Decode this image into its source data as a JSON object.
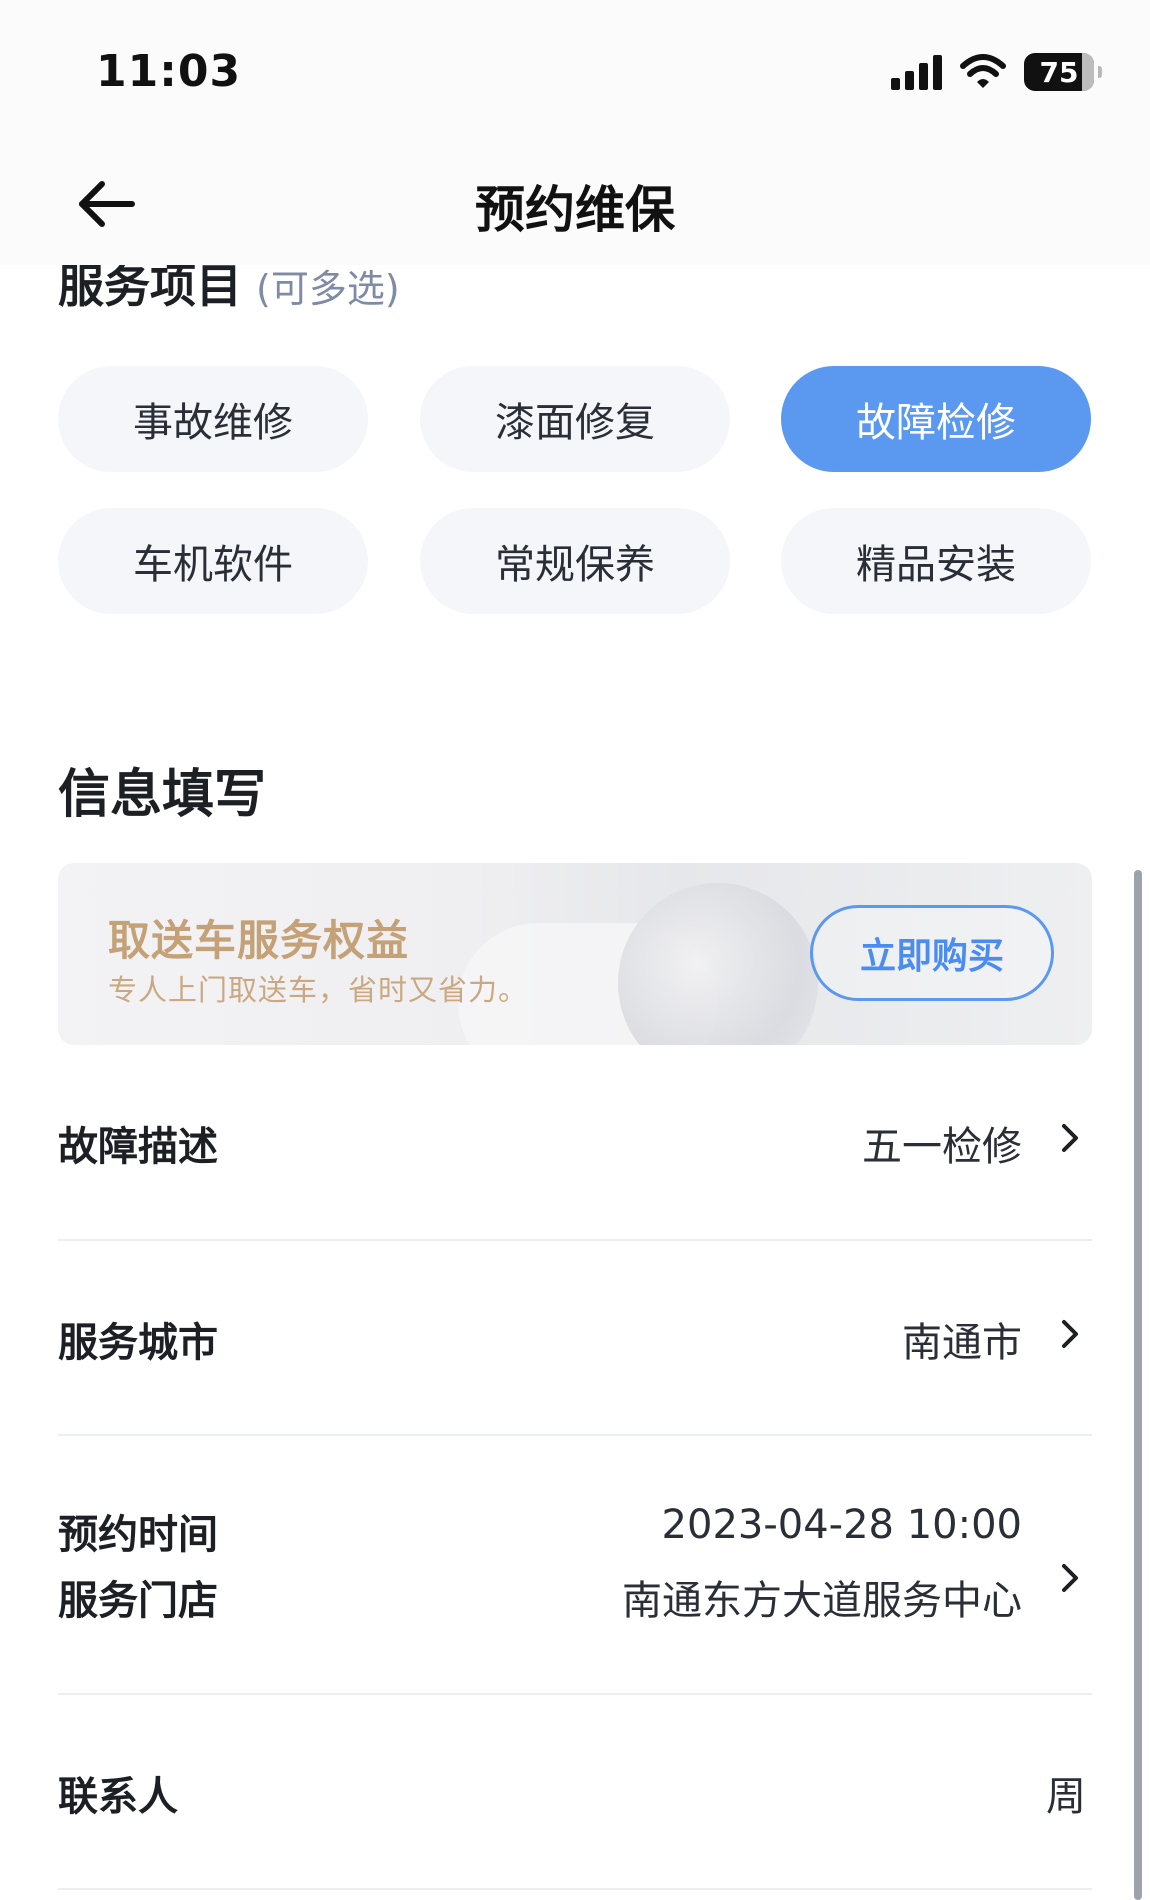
{
  "status_bar": {
    "time": "11:03",
    "battery": "75"
  },
  "nav": {
    "title": "预约维保",
    "back_icon": "arrow-left-icon"
  },
  "services": {
    "title": "服务项目",
    "subtitle": "(可多选)",
    "chips": [
      {
        "label": "事故维修",
        "selected": false
      },
      {
        "label": "漆面修复",
        "selected": false
      },
      {
        "label": "故障检修",
        "selected": true
      },
      {
        "label": "车机软件",
        "selected": false
      },
      {
        "label": "常规保养",
        "selected": false
      },
      {
        "label": "精品安装",
        "selected": false
      }
    ],
    "selected_color": "#5b98f0"
  },
  "info": {
    "title": "信息填写",
    "banner": {
      "title": "取送车服务权益",
      "subtitle": "专人上门取送车，省时又省力。",
      "button": "立即购买"
    },
    "rows": {
      "fault": {
        "label": "故障描述",
        "value": "五一检修"
      },
      "city": {
        "label": "服务城市",
        "value": "南通市"
      },
      "time": {
        "label": "预约时间",
        "value": "2023-04-28 10:00"
      },
      "store": {
        "label": "服务门店",
        "value": "南通东方大道服务中心"
      },
      "contact": {
        "label": "联系人",
        "value": "周"
      }
    }
  },
  "colors": {
    "accent": "#5b98f0",
    "gold": "#c4a176",
    "chip_bg": "#f4f6f9"
  }
}
